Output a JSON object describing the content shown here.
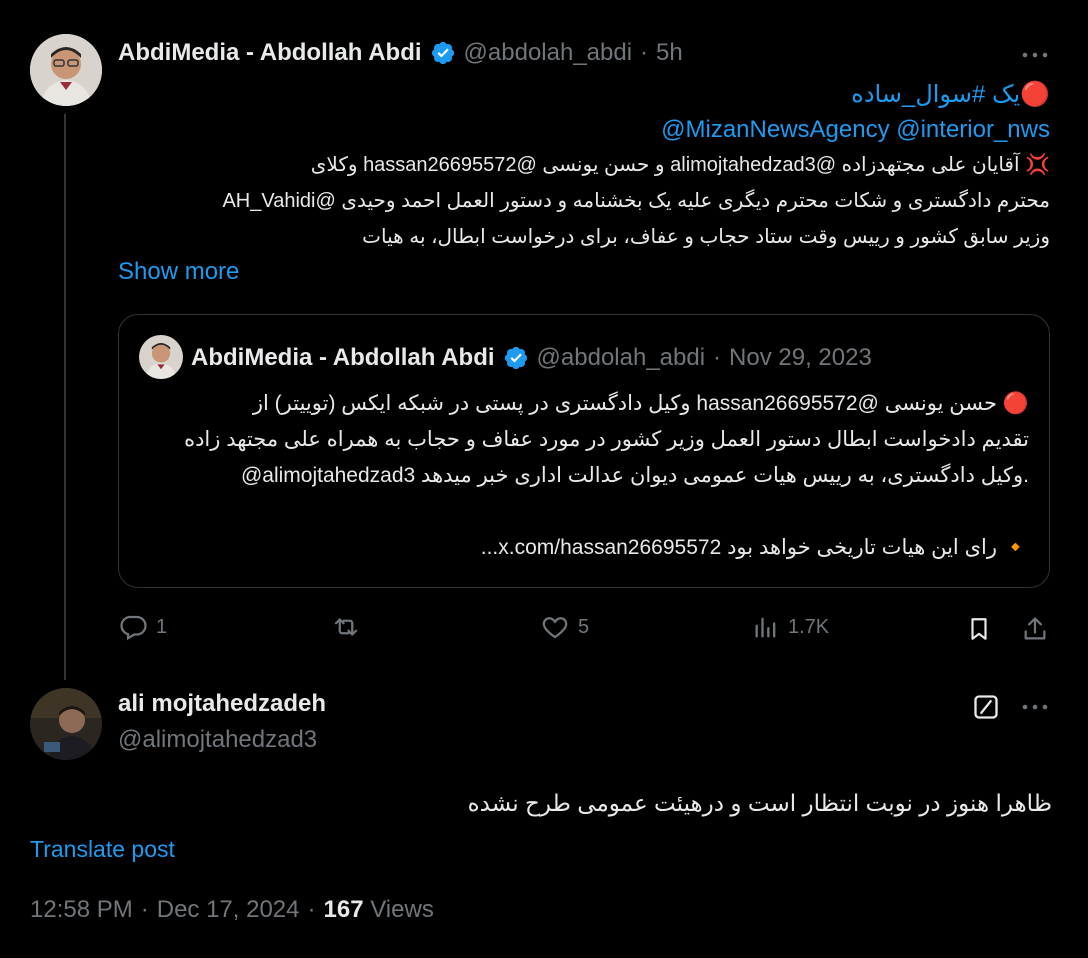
{
  "tweet": {
    "author_name": "AbdiMedia - Abdollah Abdi",
    "handle": "@abdolah_abdi",
    "dot": "·",
    "time": "5h",
    "line1": "🔴یک #سوال_ساده",
    "mentions": "@MizanNewsAgency @interior_nws",
    "line3": "💢 آقایان علی مجتهدزاده @alimojtahedzad3 و حسن یونسی @hassan26695572 وکلای",
    "line4": "محترم دادگستری و شکات محترم دیگری علیه یک بخشنامه و دستور العمل احمد وحیدی @AH_Vahidi",
    "line5": "وزیر سابق کشور و رییس وقت ستاد حجاب و عفاف، برای درخواست ابطال، به هیات",
    "show_more": "Show more",
    "actions": {
      "replies": "1",
      "likes": "5",
      "views": "1.7K"
    }
  },
  "quote": {
    "author_name": "AbdiMedia - Abdollah Abdi",
    "handle": "@abdolah_abdi",
    "dot": "·",
    "date": "Nov 29, 2023",
    "line1": "🔴 حسن یونسی @hassan26695572  وکیل دادگستری در پستی در شبکه ایکس (توییتر) از",
    "line2": "تقدیم دادخواست ابطال دستور العمل وزیر کشور در مورد عفاف و حجاب به همراه علی مجتهد زاده",
    "line3": "@alimojtahedzad3  وکیل دادگستری، به رییس هیات عمومی دیوان عدالت اداری خبر میدهد.",
    "line4": "🔸 رای این هیات تاریخی خواهد بود x.com/hassan26695572..."
  },
  "reply": {
    "author_name": "ali mojtahedzadeh",
    "handle": "@alimojtahedzad3",
    "text": "ظاهرا هنوز در نوبت انتظار است و درهیئت عمومی طرح نشده",
    "translate": "Translate post",
    "time": "12:58 PM",
    "dot": "·",
    "date": "Dec 17, 2024",
    "views_count": "167",
    "views_label": "Views"
  },
  "colors": {
    "accent": "#1d9bf0",
    "muted": "#71767b",
    "text": "#e7e9ea",
    "background": "#000000",
    "border": "#2f3336"
  }
}
